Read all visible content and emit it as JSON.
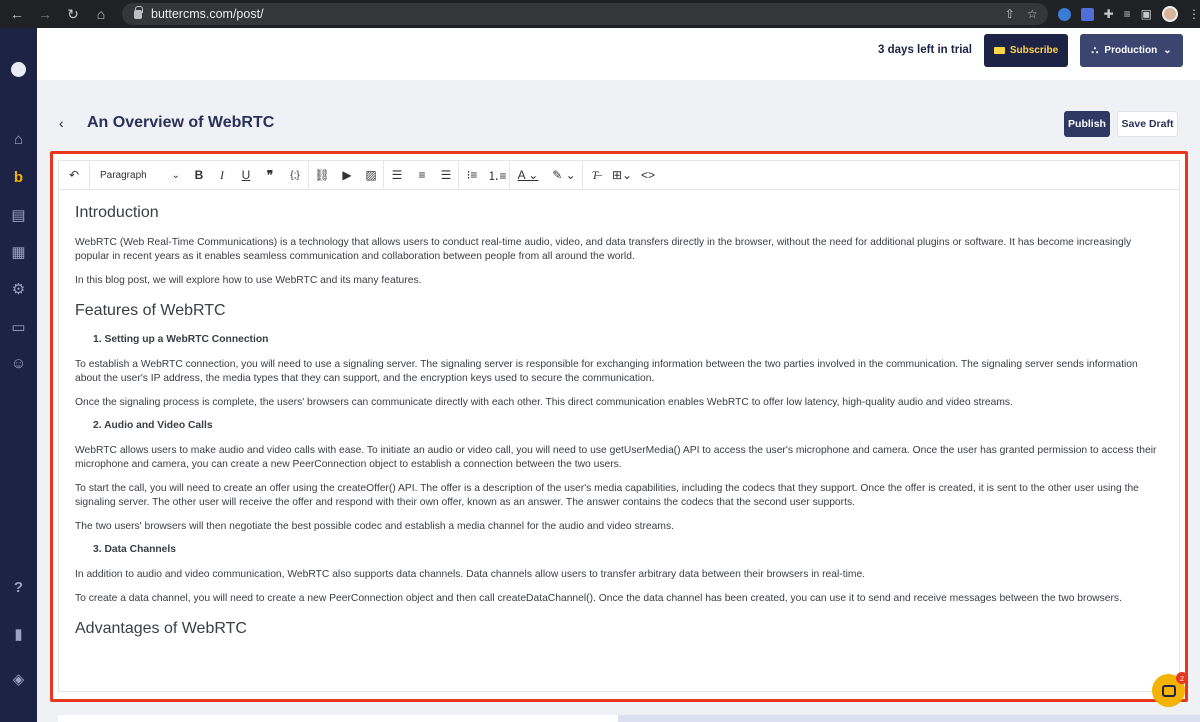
{
  "browser": {
    "url": "buttercms.com/post/"
  },
  "topbar": {
    "trial_text": "3 days left in trial",
    "subscribe_label": "Subscribe",
    "environment_label": "Production"
  },
  "post": {
    "back_glyph": "‹",
    "title": "An Overview of WebRTC",
    "publish_label": "Publish",
    "save_draft_label": "Save Draft"
  },
  "toolbar": {
    "block_format": "Paragraph"
  },
  "content": {
    "h_intro": "Introduction",
    "p_intro_1": "WebRTC (Web Real-Time Communications) is a technology that allows users to conduct real-time audio, video, and data transfers directly in the browser, without the need for additional plugins or software. It has become increasingly popular in recent years as it enables seamless communication and collaboration between people from all around the world.",
    "p_intro_2": "In this blog post, we will explore how to use WebRTC and its many features.",
    "h_features": "Features of WebRTC",
    "s1": "1. Setting up a WebRTC Connection",
    "p_s1_1": "To establish a WebRTC connection, you will need to use a signaling server. The signaling server is responsible for exchanging information between the two parties involved in the communication. The signaling server sends information about the user's IP address, the media types that they can support, and the encryption keys used to secure the communication.",
    "p_s1_2": "Once the signaling process is complete, the users' browsers can communicate directly with each other. This direct communication enables WebRTC to offer low latency, high-quality audio and video streams.",
    "s2": "2. Audio and Video Calls",
    "p_s2_1": "WebRTC allows users to make audio and video calls with ease. To initiate an audio or video call, you will need to use getUserMedia() API to access the user's microphone and camera. Once the user has granted permission to access their microphone and camera, you can create a new PeerConnection object to establish a connection between the two users.",
    "p_s2_2": "To start the call, you will need to create an offer using the createOffer() API. The offer is a description of the user's media capabilities, including the codecs that they support. Once the offer is created, it is sent to the other user using the signaling server. The other user will receive the offer and respond with their own offer, known as an answer. The answer contains the codecs that the second user supports.",
    "p_s2_3": "The two users' browsers will then negotiate the best possible codec and establish a media channel for the audio and video streams.",
    "s3": "3. Data Channels",
    "p_s3_1": "In addition to audio and video communication, WebRTC also supports data channels. Data channels allow users to transfer arbitrary data between their browsers in real-time.",
    "p_s3_2": "To create a data channel, you will need to create a new PeerConnection object and then call createDataChannel(). Once the data channel has been created, you can use it to send and receive messages between the two browsers.",
    "h_advantages": "Advantages of WebRTC"
  },
  "chat": {
    "badge_count": "2"
  },
  "colors": {
    "sidebar": "#1c2344",
    "accent": "#f5b300",
    "highlight": "#e8361f",
    "primary_button": "#2f3862"
  },
  "icons": [
    "back-icon",
    "forward-icon",
    "reload-icon",
    "home-icon",
    "lock-icon",
    "share-icon",
    "star-icon",
    "extension-icon",
    "menu-icon",
    "dashboard-icon",
    "butter-logo-icon",
    "pages-icon",
    "collections-icon",
    "components-icon",
    "media-icon",
    "users-icon",
    "help-icon",
    "docs-icon",
    "layers-icon",
    "undo-icon",
    "bold-icon",
    "italic-icon",
    "underline-icon",
    "quote-icon",
    "code-block-icon",
    "link-icon",
    "video-icon",
    "image-icon",
    "align-left-icon",
    "align-center-icon",
    "align-right-icon",
    "bullet-list-icon",
    "numbered-list-icon",
    "font-color-icon",
    "highlight-color-icon",
    "clear-format-icon",
    "table-icon",
    "source-code-icon",
    "chat-icon"
  ]
}
